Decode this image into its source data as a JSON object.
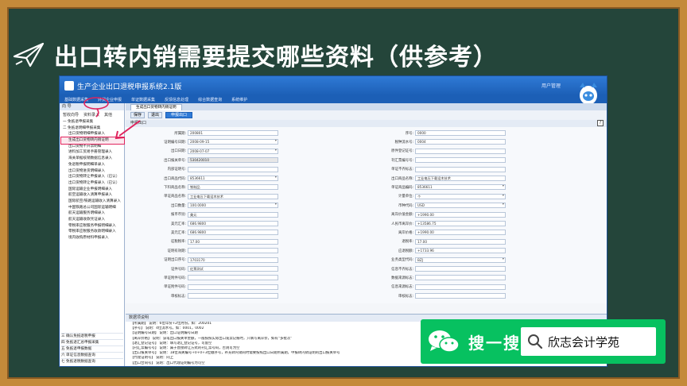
{
  "slide": {
    "title": "出口转内销需要提交哪些资料（供参考）",
    "icons": {
      "title_icon": "paper-plane-icon"
    }
  },
  "app": {
    "title": "生产企业出口退税申报系统2.1版",
    "user_label": "用户管理",
    "menu": [
      "基础数据采集",
      "外贸企业申报",
      "单证数据采集",
      "反馈信息处理",
      "综合数据查询",
      "系统维护"
    ],
    "left_panel": {
      "header": "向 导",
      "tabs": [
        "暂收向导",
        "资料录入",
        "其他"
      ],
      "tree": [
        {
          "label": "一 免抵退申报采集",
          "level": 1
        },
        {
          "label": "二 免抵退明细申报采集",
          "level": 1
        },
        {
          "label": "出口货物明细申报录入",
          "level": 2
        },
        {
          "label": "生成出口货物转内销证明",
          "level": 2,
          "selected": true
        },
        {
          "label": "出口货物不开票明细",
          "level": 2
        },
        {
          "label": "进料加工贸易手册管理录入",
          "level": 2
        },
        {
          "label": "海关单据核销数据信息录入",
          "level": 2
        },
        {
          "label": "免退税申报明细单录入",
          "level": 2
        },
        {
          "label": "出口货物进货明细录入",
          "level": 2
        },
        {
          "label": "出口货物转让申报录入（已认）",
          "level": 2
        },
        {
          "label": "出口货物转让申报录入（已认）",
          "level": 2
        },
        {
          "label": "国际运输企业申报明细录入",
          "level": 2
        },
        {
          "label": "航空运输收入清算申报录入",
          "level": 2
        },
        {
          "label": "国际航空/铁路运输收入清算录入",
          "level": 2
        },
        {
          "label": "中国铁路总公司国际运输明细",
          "level": 2
        },
        {
          "label": "航天运输服务明细录入",
          "level": 2
        },
        {
          "label": "航天运输收款凭证录入",
          "level": 2
        },
        {
          "label": "零税率应税服务申报明细录入",
          "level": 2
        },
        {
          "label": "零税率应税服务收款明细录入",
          "level": 2
        },
        {
          "label": "境内收购原材料申报录入",
          "level": 2
        }
      ],
      "bottom": [
        "三 确认免抵退税申报",
        "四 免抵退汇总申报采集",
        "五 免抵退申报数据",
        "六 单证信息数据查询",
        "七 免抵退税数据查询"
      ]
    },
    "tab": "生成出口货物转内销证明",
    "toolbar": {
      "save": "保存",
      "exit": "退出",
      "import": "申报出口"
    },
    "section": "申报出口",
    "form_left": [
      {
        "label": "所属期:",
        "value": "200801",
        "dropdown": false
      },
      {
        "label": "证明编号日期:",
        "value": "2008-09-15",
        "dropdown": true
      },
      {
        "label": "出口日期:",
        "value": "2008-07-07",
        "dropdown": true
      },
      {
        "label": "出口报关单号:",
        "value": "530420010",
        "dropdown": false,
        "masked": true
      },
      {
        "label": "内部证明号:",
        "value": "",
        "dropdown": false
      },
      {
        "label": "出口商品代码:",
        "value": "8536611",
        "dropdown": true
      },
      {
        "label": "下料商品名称:",
        "value": "铁制品",
        "dropdown": false
      },
      {
        "label": "单证商品名称:",
        "value": "工业电压下载设木技术",
        "dropdown": false
      },
      {
        "label": "出口数量:",
        "value": "100.0000",
        "dropdown": true
      },
      {
        "label": "报币币别:",
        "value": "美元",
        "dropdown": false
      },
      {
        "label": "美元汇率:",
        "value": "686.9800",
        "dropdown": false
      },
      {
        "label": "美元汇率:",
        "value": "686.9800",
        "dropdown": false
      },
      {
        "label": "征税税率:",
        "value": "17.00",
        "dropdown": false
      },
      {
        "label": "证明有效期:",
        "value": "",
        "dropdown": false
      },
      {
        "label": "证明出口序号:",
        "value": "1703170",
        "dropdown": false
      },
      {
        "label": "证件号码:",
        "value": "红票测试",
        "dropdown": false
      },
      {
        "label": "单证附件号码:",
        "value": "",
        "dropdown": false
      },
      {
        "label": "单证附件号码:",
        "value": "",
        "dropdown": false
      },
      {
        "label": "审核标志:",
        "value": "",
        "dropdown": false
      }
    ],
    "form_right": [
      {
        "label": "序号:",
        "value": "0000",
        "dropdown": false
      },
      {
        "label": "税种流水号:",
        "value": "0004",
        "dropdown": false
      },
      {
        "label": "原件登记证号:",
        "value": "",
        "dropdown": false
      },
      {
        "label": "刊汇票编号号:",
        "value": "",
        "dropdown": false
      },
      {
        "label": "单证不齐标志:",
        "value": "",
        "dropdown": false
      },
      {
        "label": "出口商品名称:",
        "value": "工业电压下载设木技术",
        "dropdown": false
      },
      {
        "label": "单证商品编码:",
        "value": "8536611",
        "dropdown": true
      },
      {
        "label": "计量单位:",
        "value": "个",
        "dropdown": true
      },
      {
        "label": "币种代码:",
        "value": "USD",
        "dropdown": true
      },
      {
        "label": "离岸价值金额:",
        "value": "+1990.00",
        "dropdown": false
      },
      {
        "label": "人民币离岸价:",
        "value": "+13586.75",
        "dropdown": false
      },
      {
        "label": "离岸价格:",
        "value": "+1990.00",
        "dropdown": false
      },
      {
        "label": "退税率:",
        "value": "17.00",
        "dropdown": false
      },
      {
        "label": "应退税额:",
        "value": "+1733.96",
        "dropdown": false
      },
      {
        "label": "业务类型代码:",
        "value": "BZJ",
        "dropdown": true
      },
      {
        "label": "信息不齐标志:",
        "value": "",
        "dropdown": false
      },
      {
        "label": "数据来源标志:",
        "value": "",
        "dropdown": false
      },
      {
        "label": "信息来源标志:",
        "value": "",
        "dropdown": false
      },
      {
        "label": "审核标志:",
        "value": "",
        "dropdown": false
      }
    ],
    "notes": {
      "header": "数据项说明",
      "lines": [
        "【所属期】    说明：6位年份+2位月份。如：200201",
        "【序号】      说明：4位流水号。如：0001，0002",
        "【证明编号日期】 说明：出口证明编号日期",
        "【离岸价格】   说明：该笔出口报关单金额，一般按照实际出口发票记账时，只填写离岸价，如有“多批次”",
        "【退汇登记证号】 说明：填写退汇登记证号，可留空",
        "【刊汇票编号号】 说明：属于直接转让方式的刊汇票号码，否则可为空",
        "【出口报关单号】 说明：18位海关编号+0+0+3位顺序号，补充转内销同时需要按照出口日期所属期，申报转内销证明的出口报关单号",
        "【代理证明号】  说明：同上",
        "【出口合同号】  说明：出口代理证明编号为可空"
      ]
    }
  },
  "banner": {
    "label": "搜一搜",
    "query": "欣志会计学苑",
    "icons": {
      "logo": "wechat-icon",
      "search": "search-icon"
    }
  }
}
